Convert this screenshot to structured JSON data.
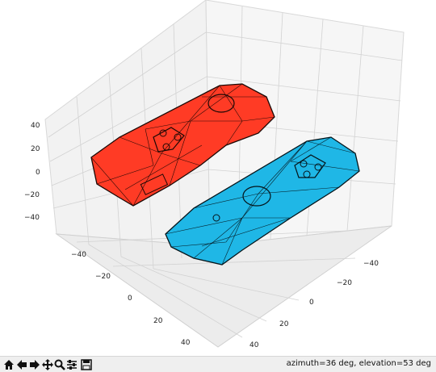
{
  "figure": {
    "axes": {
      "z_ticks": [
        "40",
        "20",
        "0",
        "−20",
        "−40"
      ],
      "left_ticks": [
        "−40",
        "−20",
        "0",
        "20",
        "40"
      ],
      "right_ticks": [
        "−40",
        "−20",
        "0",
        "20",
        "40"
      ]
    },
    "objects": [
      {
        "name": "left-joycon",
        "color": "#ff3b25"
      },
      {
        "name": "right-joycon",
        "color": "#1fb7e6"
      }
    ]
  },
  "toolbar": {
    "buttons": [
      {
        "name": "home-icon"
      },
      {
        "name": "back-arrow-icon"
      },
      {
        "name": "forward-arrow-icon"
      },
      {
        "name": "pan-icon"
      },
      {
        "name": "zoom-icon"
      },
      {
        "name": "configure-subplots-icon"
      },
      {
        "name": "save-icon"
      }
    ],
    "status": "azimuth=36 deg, elevation=53 deg"
  }
}
